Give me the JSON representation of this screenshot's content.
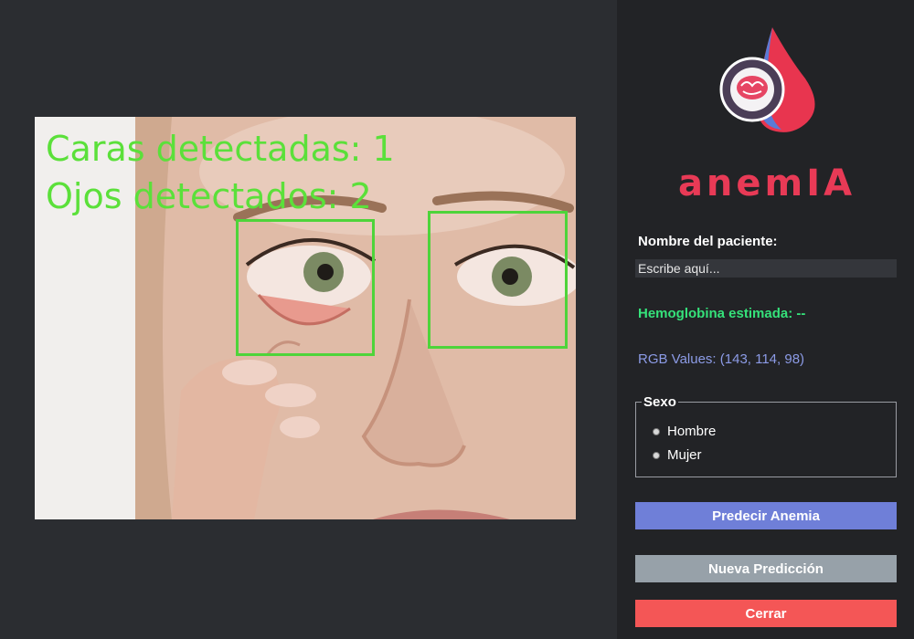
{
  "detection": {
    "faces_label": "Caras detectadas: 1",
    "eyes_label": "Ojos detectados: 2"
  },
  "brand": {
    "name": "anemIA",
    "color": "#e83a56"
  },
  "form": {
    "patient_name_label": "Nombre del paciente:",
    "patient_name_value": "Escribe aquí...",
    "hemoglobin_text": "Hemoglobina estimada: --",
    "rgb_text": "RGB Values: (143, 114, 98)",
    "sex": {
      "legend": "Sexo",
      "options": [
        "Hombre",
        "Mujer"
      ]
    }
  },
  "buttons": {
    "predict_label": "Predecir Anemia",
    "new_label": "Nueva Predicción",
    "close_label": "Cerrar"
  },
  "colors": {
    "background": "#2b2d31",
    "panel": "#222326",
    "detection_green": "#4ed43a",
    "hemoglobin_text": "#35e27a",
    "rgb_text": "#8c9be6",
    "predict_button": "#6f7fd8",
    "new_button": "#97a1a9",
    "close_button": "#f45656"
  }
}
